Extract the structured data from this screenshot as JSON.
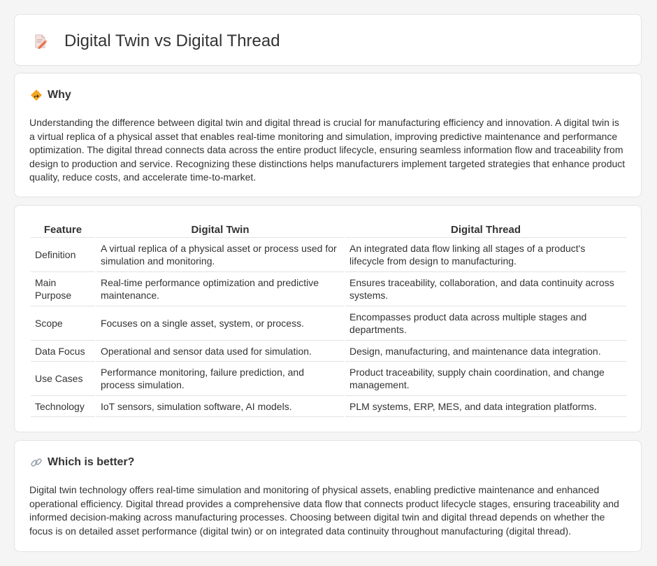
{
  "header": {
    "title": "Digital Twin vs Digital Thread",
    "icon": "document-pencil-icon"
  },
  "why": {
    "heading": "Why",
    "icon": "diamond-sign-icon",
    "text": "Understanding the difference between digital twin and digital thread is crucial for manufacturing efficiency and innovation. A digital twin is a virtual replica of a physical asset that enables real-time monitoring and simulation, improving predictive maintenance and performance optimization. The digital thread connects data across the entire product lifecycle, ensuring seamless information flow and traceability from design to production and service. Recognizing these distinctions helps manufacturers implement targeted strategies that enhance product quality, reduce costs, and accelerate time-to-market."
  },
  "table": {
    "headers": [
      "Feature",
      "Digital Twin",
      "Digital Thread"
    ],
    "rows": [
      [
        "Definition",
        "A virtual replica of a physical asset or process used for simulation and monitoring.",
        "An integrated data flow linking all stages of a product's lifecycle from design to manufacturing."
      ],
      [
        "Main Purpose",
        "Real-time performance optimization and predictive maintenance.",
        "Ensures traceability, collaboration, and data continuity across systems."
      ],
      [
        "Scope",
        "Focuses on a single asset, system, or process.",
        "Encompasses product data across multiple stages and departments."
      ],
      [
        "Data Focus",
        "Operational and sensor data used for simulation.",
        "Design, manufacturing, and maintenance data integration."
      ],
      [
        "Use Cases",
        "Performance monitoring, failure prediction, and process simulation.",
        "Product traceability, supply chain coordination, and change management."
      ],
      [
        "Technology",
        "IoT sensors, simulation software, AI models.",
        "PLM systems, ERP, MES, and data integration platforms."
      ]
    ]
  },
  "better": {
    "heading": "Which is better?",
    "icon": "link-icon",
    "text": "Digital twin technology offers real-time simulation and monitoring of physical assets, enabling predictive maintenance and enhanced operational efficiency. Digital thread provides a comprehensive data flow that connects product lifecycle stages, ensuring traceability and informed decision-making across manufacturing processes. Choosing between digital twin and digital thread depends on whether the focus is on detailed asset performance (digital twin) or on integrated data continuity throughout manufacturing (digital thread)."
  }
}
